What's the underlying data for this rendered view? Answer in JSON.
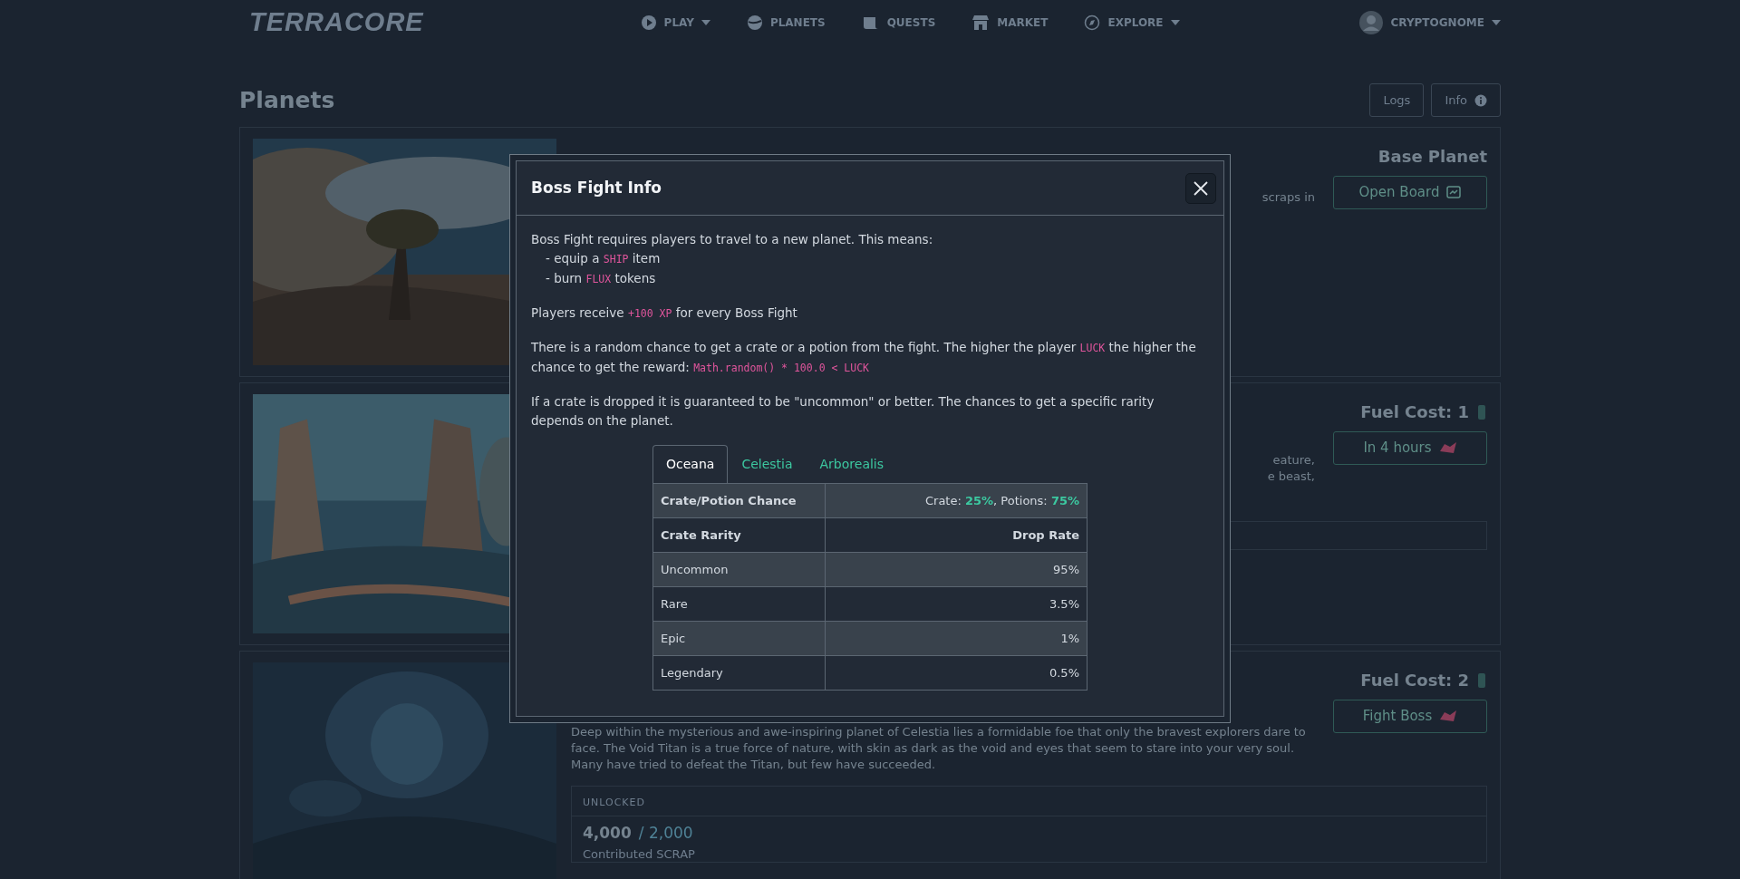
{
  "navbar": {
    "logo": "TERRACORE",
    "items": [
      {
        "label": "PLAY",
        "dropdown": true
      },
      {
        "label": "PLANETS",
        "dropdown": false
      },
      {
        "label": "QUESTS",
        "dropdown": false
      },
      {
        "label": "MARKET",
        "dropdown": false
      },
      {
        "label": "EXPLORE",
        "dropdown": true
      }
    ],
    "user": {
      "name": "CRYPTOGNOME",
      "dropdown": true
    }
  },
  "page": {
    "title": "Planets",
    "buttons": [
      "Logs",
      "Info"
    ]
  },
  "planets": [
    {
      "tag": "Base Planet",
      "button": "Open Board",
      "fragments": [
        "scraps in"
      ]
    },
    {
      "tag": "Fuel Cost: 1",
      "button": "In 4 hours",
      "fragments": [
        "eature,",
        "e beast,"
      ],
      "box": true
    },
    {
      "tag": "Fuel Cost: 2",
      "button": "Fight Boss",
      "description": "Deep within the mysterious and awe-inspiring planet of Celestia lies a formidable foe that only the bravest explorers dare to face. The Void Titan is a true force of nature, with skin as dark as the void and eyes that seem to stare into your very soul. Many have tried to defeat the Titan, but few have succeeded.",
      "status": "UNLOCKED",
      "amount": "4,000",
      "goal": "/ 2,000",
      "amount_label": "Contributed SCRAP"
    }
  ],
  "modal": {
    "title": "Boss Fight Info",
    "paragraphs": [
      {
        "segments": [
          {
            "kind": "text",
            "text": "Boss Fight requires players to travel to a new planet. This means:"
          }
        ],
        "children": [
          {
            "segments": [
              {
                "kind": "text",
                "text": "- equip a "
              },
              {
                "kind": "code",
                "text": "SHIP"
              },
              {
                "kind": "text",
                "text": " item"
              }
            ]
          },
          {
            "segments": [
              {
                "kind": "text",
                "text": "- burn "
              },
              {
                "kind": "code",
                "text": "FLUX"
              },
              {
                "kind": "text",
                "text": " tokens"
              }
            ]
          }
        ]
      },
      {
        "segments": [
          {
            "kind": "text",
            "text": "Players receive "
          },
          {
            "kind": "code",
            "text": "+100 XP"
          },
          {
            "kind": "text",
            "text": " for every Boss Fight"
          }
        ]
      },
      {
        "segments": [
          {
            "kind": "text",
            "text": "There is a random chance to get a crate or a potion from the fight. The higher the player "
          },
          {
            "kind": "code",
            "text": "LUCK"
          },
          {
            "kind": "text",
            "text": " the higher the chance to get the reward: "
          },
          {
            "kind": "code",
            "text": "Math.random() * 100.0 < LUCK"
          }
        ]
      },
      {
        "segments": [
          {
            "kind": "text",
            "text": "If a crate is dropped it is guaranteed to be \"uncommon\" or better. The chances to get a specific rarity depends on the planet."
          }
        ]
      }
    ],
    "tabs": [
      {
        "label": "Oceana",
        "selected": true
      },
      {
        "label": "Celestia",
        "selected": false
      },
      {
        "label": "Arborealis",
        "selected": false
      }
    ],
    "chance": {
      "label": "Crate/Potion Chance",
      "segments": [
        {
          "kind": "text",
          "text": "Crate: "
        },
        {
          "kind": "accent",
          "text": "25%"
        },
        {
          "kind": "text",
          "text": ", Potions: "
        },
        {
          "kind": "accent",
          "text": "75%"
        }
      ]
    },
    "columns": [
      "Crate Rarity",
      "Drop Rate"
    ],
    "rows": [
      {
        "rarity": "Uncommon",
        "rate": "95%"
      },
      {
        "rarity": "Rare",
        "rate": "3.5%"
      },
      {
        "rarity": "Epic",
        "rate": "1%"
      },
      {
        "rarity": "Legendary",
        "rate": "0.5%"
      }
    ]
  }
}
